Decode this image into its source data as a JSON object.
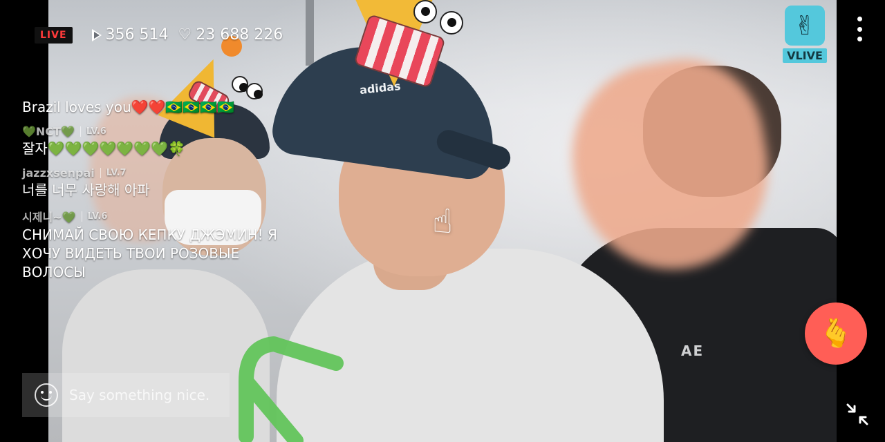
{
  "top_bar": {
    "live_label": "LIVE",
    "play_count": "356 514",
    "heart_count": "23 688 226"
  },
  "brand": {
    "logo_text": "VLIVE"
  },
  "chat": {
    "messages": [
      {
        "user": "",
        "level": "",
        "text": "Brazil loves you❤️❤️🇧🇷🇧🇷🇧🇷🇧🇷"
      },
      {
        "user": "💚NCT💚",
        "level": "LV.6",
        "text": "잘자💚💚💚💚💚💚💚🍀"
      },
      {
        "user": "jazzxsenpai",
        "level": "LV.7",
        "text": "너를 너무 사랑해 아파"
      },
      {
        "user": "시제니~💚",
        "level": "LV.6",
        "text": "СНИМАЙ СВОЮ КЕПКУ ДЖЭМИН! Я ХОЧУ ВИДЕТЬ ТВОИ РОЗОВЫЕ ВОЛОСЫ"
      }
    ]
  },
  "input": {
    "placeholder": "Say something nice."
  },
  "video": {
    "cap_logo": "adidas",
    "shirt_text": "AE"
  },
  "icons": {
    "play": "play-icon",
    "heart": "heart-outline-icon",
    "menu": "more-vert-icon",
    "emoji": "smile-icon",
    "tap": "finger-tap-icon",
    "send_heart": "finger-heart-icon",
    "shrink": "shrink-icon"
  },
  "colors": {
    "live_red": "#ff3a3a",
    "vlive_cyan": "#54c8dc",
    "heart_button": "#ff5e56",
    "arrow_green": "#62c45b"
  }
}
